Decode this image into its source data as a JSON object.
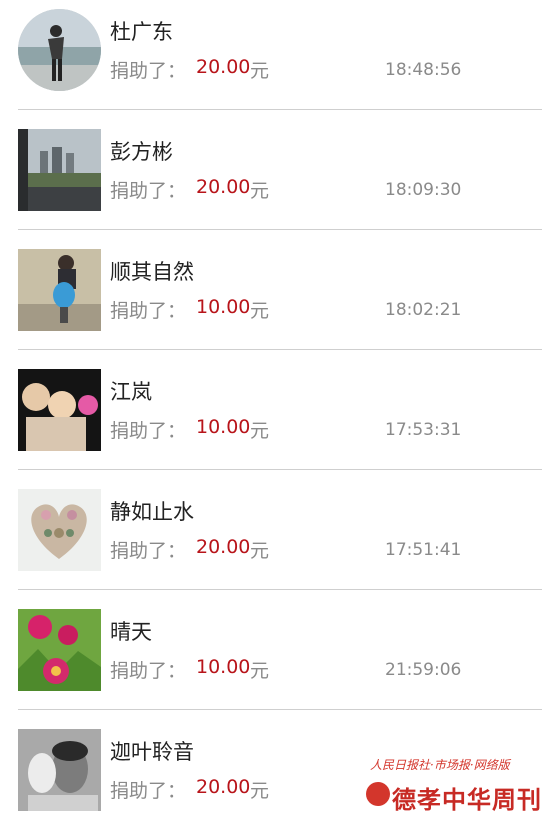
{
  "donations": [
    {
      "name": "杜广东",
      "label": "捐助了：",
      "amount": "20.00",
      "unit": "元",
      "time": "18:48:56",
      "avatar": "person-on-riverbank-avatar"
    },
    {
      "name": "彭方彬",
      "label": "捐助了：",
      "amount": "20.00",
      "unit": "元",
      "time": "18:09:30",
      "avatar": "city-road-avatar"
    },
    {
      "name": "顺其自然",
      "label": "捐助了：",
      "amount": "10.00",
      "unit": "元",
      "time": "18:02:21",
      "avatar": "child-on-toy-avatar"
    },
    {
      "name": "江岚",
      "label": "捐助了：",
      "amount": "10.00",
      "unit": "元",
      "time": "17:53:31",
      "avatar": "two-children-avatar"
    },
    {
      "name": "静如止水",
      "label": "捐助了：",
      "amount": "20.00",
      "unit": "元",
      "time": "17:51:41",
      "avatar": "flower-heart-avatar"
    },
    {
      "name": "晴天",
      "label": "捐助了：",
      "amount": "10.00",
      "unit": "元",
      "time": "21:59:06",
      "avatar": "peony-flower-avatar"
    },
    {
      "name": "迦叶聆音",
      "label": "捐助了：",
      "amount": "20.00",
      "unit": "元",
      "time": "",
      "avatar": "man-with-mask-avatar"
    }
  ],
  "watermark": {
    "top_text": "人民日报社·市场报·网络版",
    "main_text": "德孝中华周刊"
  },
  "colors": {
    "amount": "#b8141a",
    "muted": "#8a8a8a",
    "name": "#222222",
    "divider": "#cfcfcf"
  }
}
